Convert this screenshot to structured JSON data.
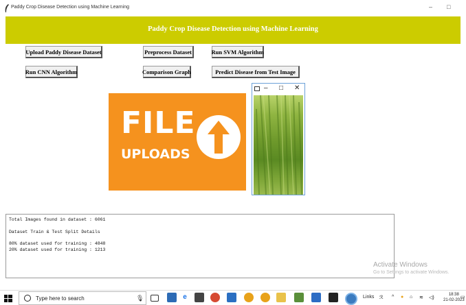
{
  "window": {
    "title": "Paddy Crop Disease Detection using Machine Learning",
    "minimize": "–",
    "maximize": "□"
  },
  "banner": {
    "heading": "Paddy Crop Disease Detection using Machine Learning",
    "color": "#cccc00"
  },
  "buttons": {
    "upload": "Upload Paddy Disease Dataset",
    "preprocess": "Preprocess Dataset",
    "svm": "Run SVM Algorithm",
    "cnn": "Run CNN Algorithm",
    "comparison": "Comparison Graph",
    "predict": "Predict Disease from Test Image"
  },
  "file_uploads_image": {
    "line1": "FILE",
    "line2": "UPLOADS",
    "color": "#f5921e"
  },
  "popup": {
    "minimize": "–",
    "maximize": "□",
    "close": "✕"
  },
  "output": {
    "lines": [
      "Total Images found in dataset : 6061",
      "",
      "Dataset Train & Test Split Details",
      "",
      "80% dataset used for training : 4848",
      "20% dataset used for training : 1213"
    ]
  },
  "watermark": {
    "title": "Activate Windows",
    "subtitle": "Go to Settings to activate Windows."
  },
  "taskbar": {
    "search_placeholder": "Type here to search",
    "links_label": "Links",
    "time": "18:38",
    "date": "21-02-2023",
    "icons": [
      "task-view-icon",
      "snip-icon",
      "edge-icon",
      "store-icon",
      "app-icon",
      "pdf-icon",
      "chrome-icon",
      "chrome-icon-2",
      "file-explorer-icon",
      "paint-icon",
      "app-icon-2",
      "terminal-icon",
      "python-icon"
    ]
  }
}
